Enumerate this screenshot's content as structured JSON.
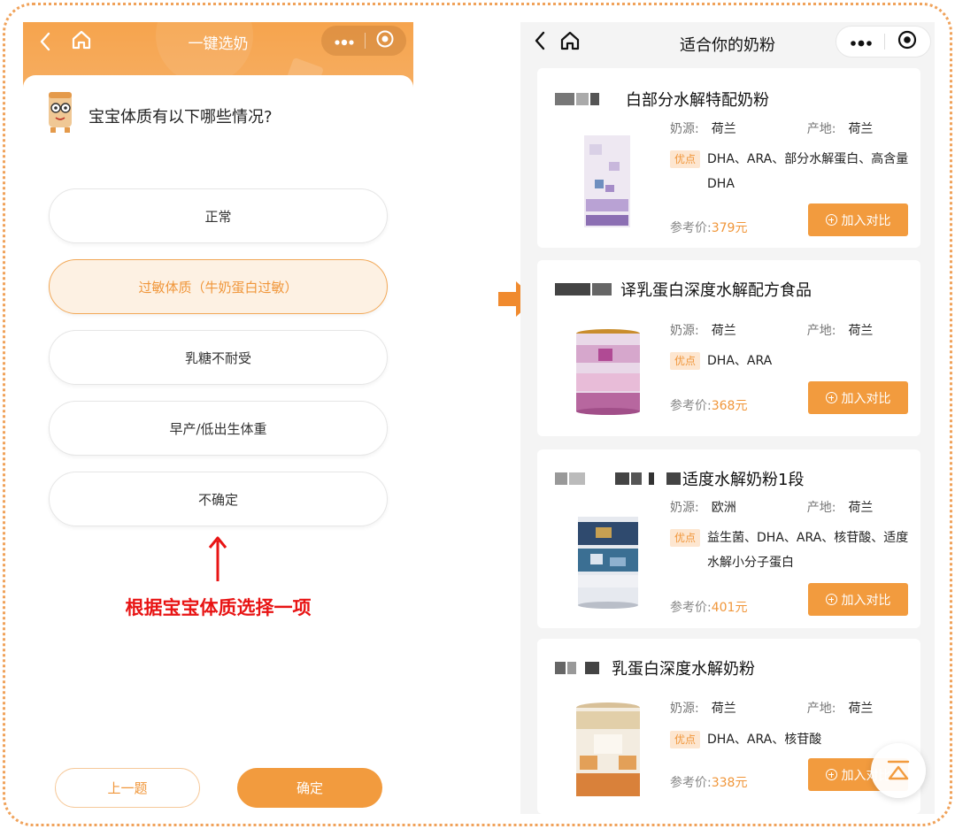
{
  "left": {
    "nav_title": "一键选奶",
    "question": "宝宝体质有以下哪些情况?",
    "options": [
      {
        "label": "正常",
        "selected": false
      },
      {
        "label": "过敏体质（牛奶蛋白过敏）",
        "selected": true
      },
      {
        "label": "乳糖不耐受",
        "selected": false
      },
      {
        "label": "早产/低出生体重",
        "selected": false
      },
      {
        "label": "不确定",
        "selected": false
      }
    ],
    "hint": "根据宝宝体质选择一项",
    "prev_label": "上一题",
    "ok_label": "确定"
  },
  "right": {
    "nav_title": "适合你的奶粉",
    "source_label": "奶源:",
    "origin_label": "产地:",
    "adv_tag": "优点",
    "price_label": "参考价:",
    "add_label": "加入对比",
    "products": [
      {
        "name": "白部分水解特配奶粉",
        "source": "荷兰",
        "origin": "荷兰",
        "advantages": "DHA、ARA、部分水解蛋白、高含量DHA",
        "price": "379元"
      },
      {
        "name": "译乳蛋白深度水解配方食品",
        "source": "荷兰",
        "origin": "荷兰",
        "advantages": "DHA、ARA",
        "price": "368元"
      },
      {
        "name": "适度水解奶粉1段",
        "source": "欧洲",
        "origin": "荷兰",
        "advantages": "益生菌、DHA、ARA、核苷酸、适度水解小分子蛋白",
        "price": "401元"
      },
      {
        "name": "乳蛋白深度水解奶粉",
        "source": "荷兰",
        "origin": "荷兰",
        "advantages": "DHA、ARA、核苷酸",
        "price": "338元"
      }
    ]
  },
  "colors": {
    "accent": "#f29b3e",
    "hint_red": "#e81414",
    "selected_bg": "#fdf1e3"
  }
}
